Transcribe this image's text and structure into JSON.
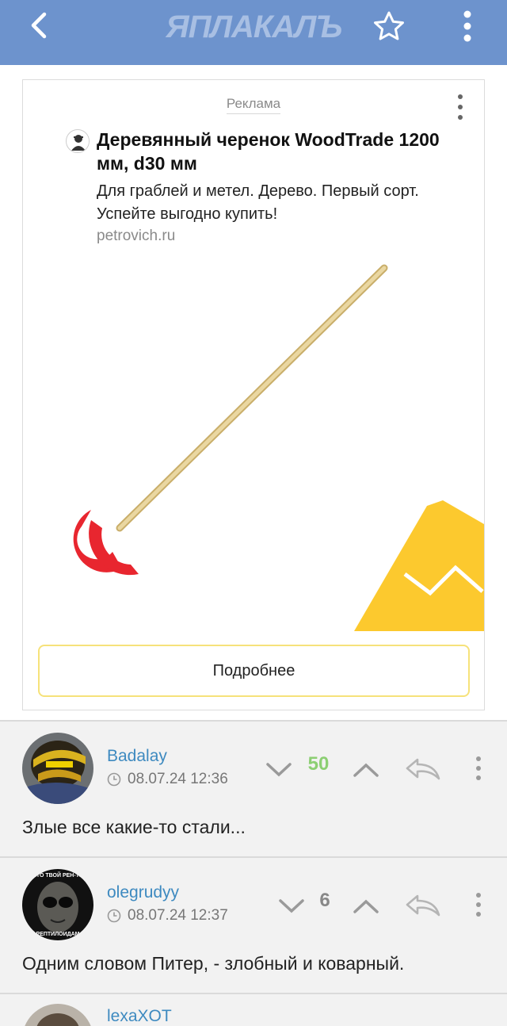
{
  "header": {
    "logo_text": "ЯПЛАКАЛЪ",
    "back_icon": "chevron-left-icon",
    "star_icon": "star-outline-icon",
    "menu_icon": "more-vertical-icon"
  },
  "ad": {
    "label": "Реклама",
    "title": "Деревянный черенок WoodTrade 1200 мм, d30 мм",
    "description": "Для граблей и метел. Дерево. Первый сорт. Успейте выгодно купить!",
    "domain": "petrovich.ru",
    "button_label": "Подробнее",
    "colors": {
      "red": "#e8262f",
      "yellow": "#fcc92e",
      "handle": "#e3cc8c"
    }
  },
  "comments": [
    {
      "username": "Badalay",
      "datetime": "08.07.24 12:36",
      "score": "50",
      "score_color": "#8ccf73",
      "text": "Злые все какие-то стали..."
    },
    {
      "username": "olegrudyy",
      "datetime": "08.07.24 12:37",
      "score": "6",
      "score_color": "#888888",
      "text": "Одним словом Питер, - злобный и коварный.",
      "avatar_caption_top": "ЧТО ТВОЙ РЕН-ТВ",
      "avatar_caption_bottom": "РЕПТИЛОИДАМ"
    },
    {
      "username": "lexaXOT"
    }
  ],
  "theme": {
    "header_bg": "#6d93cd",
    "link_color": "#3e8ac0"
  }
}
